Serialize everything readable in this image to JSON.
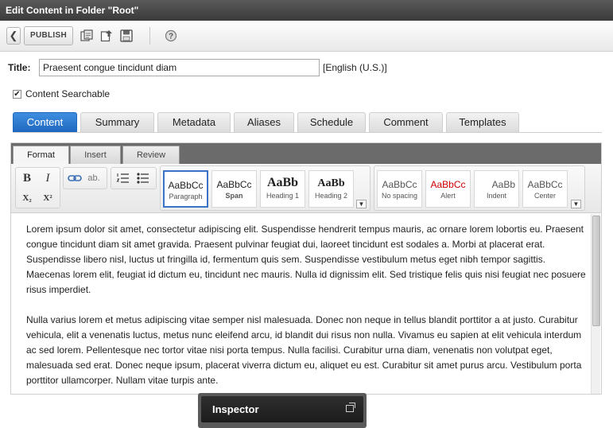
{
  "window": {
    "title": "Edit Content in Folder \"Root\""
  },
  "toolbar": {
    "back_icon": "chevron-left-icon",
    "publish_label": "PUBLISH",
    "icons": [
      "copy-icon",
      "upload-icon",
      "save-icon",
      "help-icon"
    ]
  },
  "form": {
    "title_label": "Title:",
    "title_value": "Praesent congue tincidunt diam",
    "language": "[English (U.S.)]",
    "searchable_label": "Content Searchable",
    "searchable_checked": true
  },
  "tabs": [
    "Content",
    "Summary",
    "Metadata",
    "Aliases",
    "Schedule",
    "Comment",
    "Templates"
  ],
  "active_tab": "Content",
  "ribbon": {
    "tabs": [
      "Format",
      "Insert",
      "Review"
    ],
    "active_tab": "Format",
    "buttons": {
      "bold": "B",
      "italic": "I",
      "subscript": "X₂",
      "superscript": "X²",
      "clear_format": "ab."
    },
    "styles_group1": [
      {
        "sample": "AaBbCc",
        "name": "Paragraph"
      },
      {
        "sample": "AaBbCc",
        "name": "Span"
      },
      {
        "sample": "AaBb",
        "name": "Heading 1"
      },
      {
        "sample": "AaBb",
        "name": "Heading 2"
      }
    ],
    "styles_group2": [
      {
        "sample": "AaBbCc",
        "name": "No spacing"
      },
      {
        "sample": "AaBbCc",
        "name": "Alert"
      },
      {
        "sample": "AaBb",
        "name": "Indent"
      },
      {
        "sample": "AaBbCc",
        "name": "Center"
      }
    ],
    "alert_color": "#cc0000"
  },
  "content": {
    "paragraphs": [
      "Lorem ipsum dolor sit amet, consectetur adipiscing elit. Suspendisse hendrerit tempus mauris, ac ornare lorem lobortis eu. Praesent congue tincidunt diam sit amet gravida. Praesent pulvinar feugiat dui, laoreet tincidunt est sodales a. Morbi at placerat erat. Suspendisse libero nisl, luctus ut fringilla id, fermentum quis sem. Suspendisse vestibulum metus eget nibh tempor sagittis. Maecenas lorem elit, feugiat id dictum eu, tincidunt nec mauris. Nulla id dignissim elit. Sed tristique felis quis nisi feugiat nec posuere risus imperdiet.",
      "Nulla varius lorem et metus adipiscing vitae semper nisl malesuada. Donec non neque in tellus blandit porttitor a at justo. Curabitur vehicula, elit a venenatis luctus, metus nunc eleifend arcu, id blandit dui risus non nulla. Vivamus eu sapien at elit vehicula interdum ac sed lorem. Pellentesque nec tortor vitae nisi porta tempus. Nulla facilisi. Curabitur urna diam, venenatis non volutpat eget, malesuada sed erat. Donec neque ipsum, placerat viverra dictum eu, aliquet eu est. Curabitur sit amet purus arcu. Vestibulum porta porttitor ullamcorper. Nullam vitae turpis ante."
    ]
  },
  "inspector": {
    "label": "Inspector",
    "popout_icon": "popout-icon"
  },
  "colors": {
    "accent": "#1f68bf",
    "titlebar": "#3a3a3a"
  }
}
